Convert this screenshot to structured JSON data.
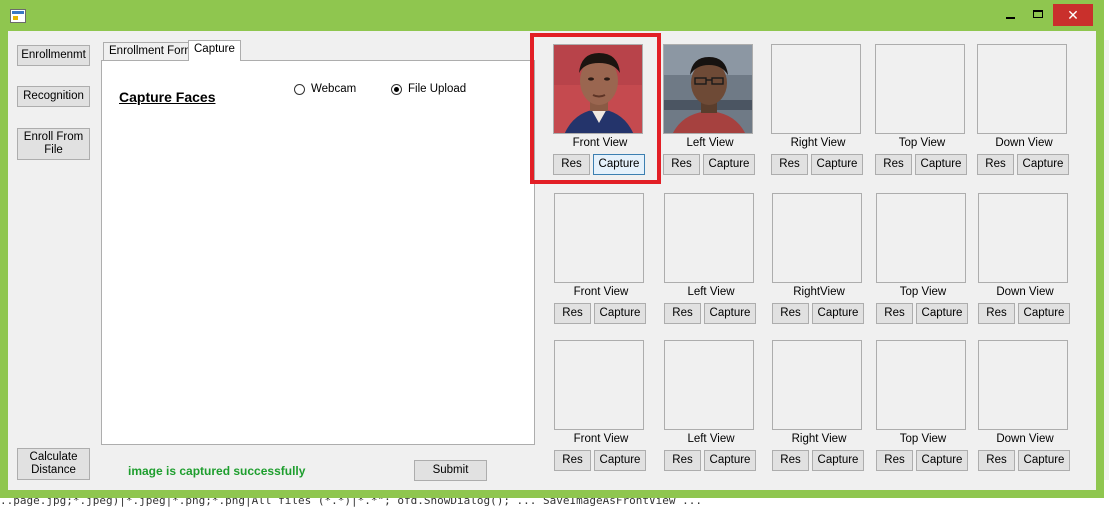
{
  "background": {
    "code_line": "..page.jpg;*.jpeg)|*.jpeg|*.png;*.png|All files (*.*)|*.*\"; ofd.ShowDialog(); ... SaveImageAsFrontView ..."
  },
  "window": {
    "controls": {
      "minimize": "",
      "maximize": "",
      "close": "✕"
    }
  },
  "sidebar": {
    "enrollment": "Enrollmenmt",
    "recognition": "Recognition",
    "enroll_from_file": "Enroll From File",
    "calculate_distance": "Calculate Distance"
  },
  "tabs": {
    "enrollment_form": "Enrollment Form",
    "capture": "Capture"
  },
  "capture_panel": {
    "title": "Capture Faces",
    "webcam_label": "Webcam",
    "file_upload_label": "File Upload",
    "selected_source": "File Upload"
  },
  "status": {
    "message": "image is captured successfully",
    "color": "#1e9e2e"
  },
  "submit_label": "Submit",
  "buttons": {
    "res": "Res",
    "capture": "Capture"
  },
  "grid": {
    "rows": [
      {
        "labels": [
          "Front View",
          "Left View",
          "Right View",
          "Top View",
          "Down View"
        ]
      },
      {
        "labels": [
          "Front View",
          "Left View",
          "RightView",
          "Top View",
          "Down View"
        ]
      },
      {
        "labels": [
          "Front View",
          "Left View",
          "Right View",
          "Top View",
          "Down View"
        ]
      }
    ],
    "filled": [
      "front-view-1",
      "left-view-1"
    ]
  },
  "colors": {
    "window_accent": "#8fc64f",
    "highlight": "#e21f26",
    "close_button": "#c9302c"
  }
}
